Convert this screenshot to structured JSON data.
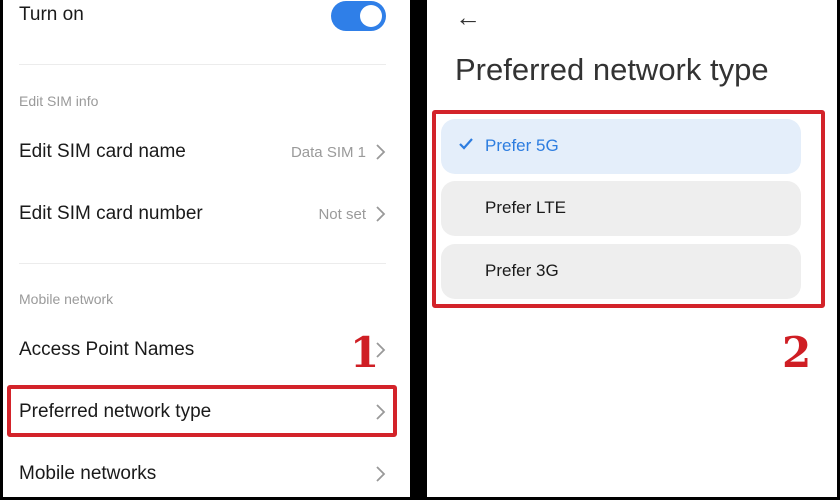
{
  "left_panel": {
    "turn_on": "Turn on",
    "toggle_state": "on",
    "section_edit_sim": "Edit SIM info",
    "edit_sim_name": {
      "label": "Edit SIM card name",
      "value": "Data SIM 1"
    },
    "edit_sim_number": {
      "label": "Edit SIM card number",
      "value": "Not set"
    },
    "section_mobile_network": "Mobile network",
    "access_point_names": "Access Point Names",
    "preferred_network_type": "Preferred network type",
    "mobile_networks": "Mobile networks",
    "step_marker": "1"
  },
  "right_panel": {
    "back_arrow": "←",
    "title": "Preferred network type",
    "options": [
      {
        "label": "Prefer 5G",
        "selected": true
      },
      {
        "label": "Prefer LTE",
        "selected": false
      },
      {
        "label": "Prefer 3G",
        "selected": false
      }
    ],
    "step_marker": "2"
  },
  "colors": {
    "toggle_on": "#2f7fe8",
    "highlight_red": "#d3232a",
    "selected_text": "#2d7de0",
    "selected_bg": "#e4eefa"
  },
  "icons": [
    "chevron-right-icon",
    "back-arrow-icon",
    "checkmark-icon"
  ]
}
